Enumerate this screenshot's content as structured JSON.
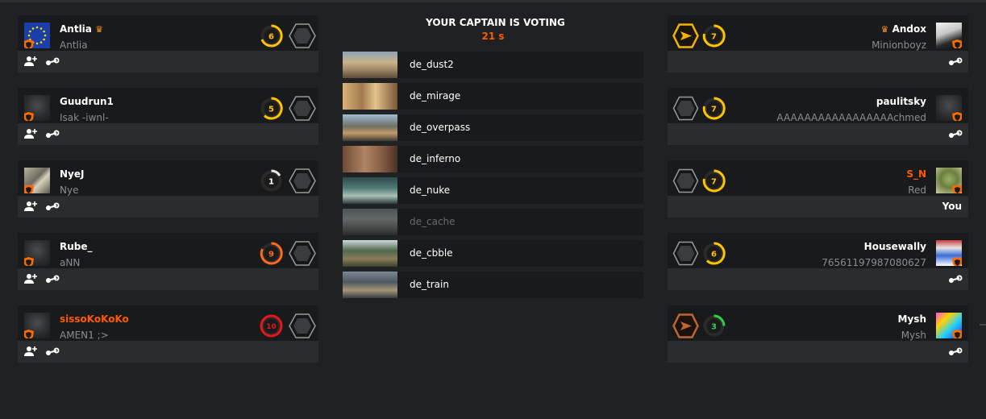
{
  "colors": {
    "background": "#1f2122",
    "card_top": "#191a1c",
    "card_bottom": "#2a2d2e",
    "accent_orange": "#ff5a00",
    "nickname_gray": "#8a8d90"
  },
  "center": {
    "title": "YOUR CAPTAIN IS VOTING",
    "timer": "21 s",
    "maps": [
      {
        "name": "de_dust2",
        "disabled": false
      },
      {
        "name": "de_mirage",
        "disabled": false
      },
      {
        "name": "de_overpass",
        "disabled": false
      },
      {
        "name": "de_inferno",
        "disabled": false
      },
      {
        "name": "de_nuke",
        "disabled": false
      },
      {
        "name": "de_cache",
        "disabled": true
      },
      {
        "name": "de_cbble",
        "disabled": false
      },
      {
        "name": "de_train",
        "disabled": false
      }
    ]
  },
  "left_team": [
    {
      "name": "Antlia",
      "nickname": "Antlia",
      "level": "6",
      "captain": true,
      "crown_icon": "crown-icon",
      "avatar_icon": "eu-flag-avatar"
    },
    {
      "name": "Guudrun1",
      "nickname": "Isak -iwnl-",
      "level": "5",
      "captain": false,
      "avatar_icon": "default-avatar"
    },
    {
      "name": "NyeJ",
      "nickname": "Nye",
      "level": "1",
      "captain": false,
      "avatar_icon": "wolf-avatar"
    },
    {
      "name": "Rube_",
      "nickname": "aNN",
      "level": "9",
      "captain": false,
      "avatar_icon": "default-avatar"
    },
    {
      "name": "sissoKoKoKo",
      "nickname": "AMEN1 ;>",
      "level": "10",
      "captain": false,
      "name_color": "#ff5a00",
      "avatar_icon": "default-avatar"
    }
  ],
  "right_team": [
    {
      "name": "Andox",
      "nickname": "Minionboyz",
      "level": "7",
      "captain": true,
      "crown_icon": "crown-icon",
      "rank_icon": "gold-hex-rank-icon",
      "avatar_icon": "man-avatar",
      "footer": ""
    },
    {
      "name": "paulitsky",
      "nickname": "AAAAAAAAAAAAAAAAAchmed",
      "level": "7",
      "captain": false,
      "rank_icon": "unranked-hex-icon",
      "avatar_icon": "default-avatar",
      "footer": ""
    },
    {
      "name": "S_N",
      "nickname": "Red",
      "level": "7",
      "captain": false,
      "name_color": "#ff5a00",
      "rank_icon": "unranked-hex-icon",
      "avatar_icon": "turtle-avatar",
      "footer": "You"
    },
    {
      "name": "Housewally",
      "nickname": "76561197987080627",
      "level": "6",
      "captain": false,
      "rank_icon": "unranked-hex-icon",
      "avatar_icon": "house-avatar",
      "footer": ""
    },
    {
      "name": "Mysh",
      "nickname": "Mysh",
      "level": "3",
      "captain": false,
      "rank_icon": "bronze-hex-rank-icon",
      "avatar_icon": "mysh-avatar",
      "footer": ""
    }
  ]
}
